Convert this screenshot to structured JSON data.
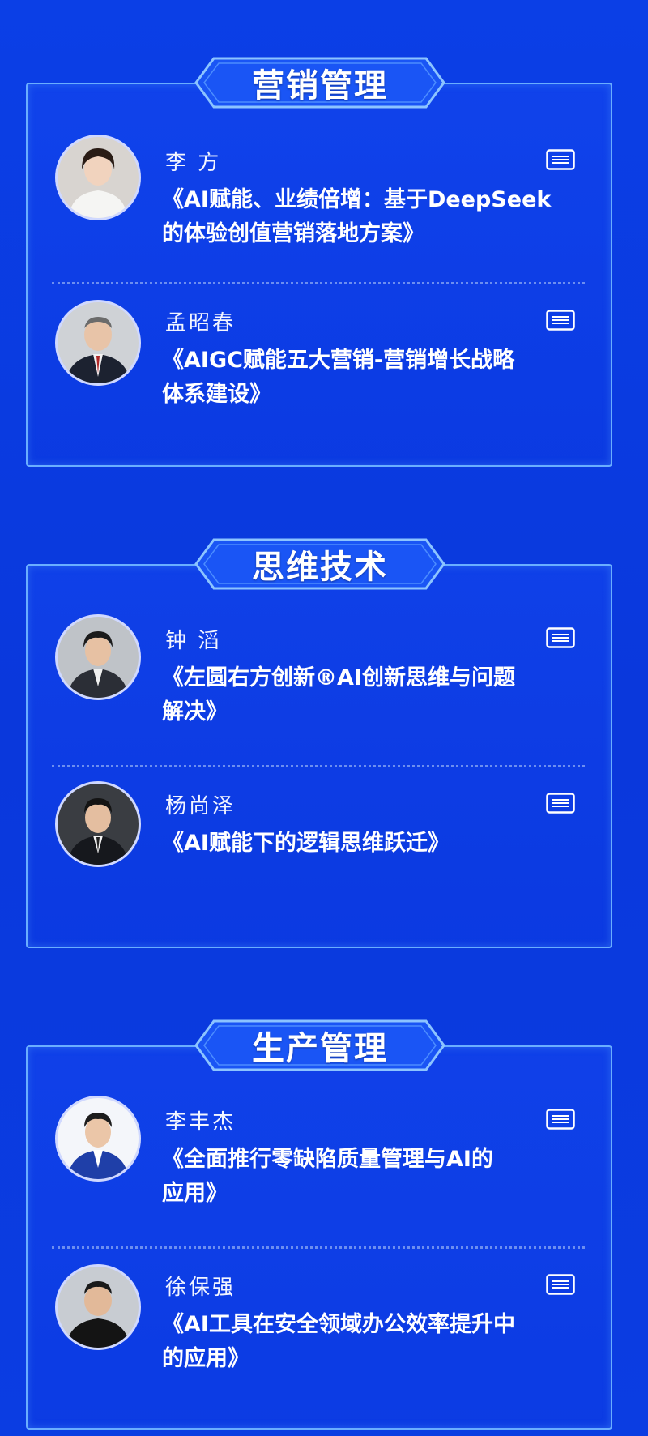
{
  "sections": [
    {
      "badge": "营销管理",
      "speakers": [
        {
          "name": "李 方",
          "title": "《AI赋能、业绩倍增：基于DeepSeek\n的体验创值营销落地方案》"
        },
        {
          "name": "孟昭春",
          "title": "《AIGC赋能五大营销-营销增长战略\n体系建设》"
        }
      ]
    },
    {
      "badge": "思维技术",
      "speakers": [
        {
          "name": "钟 滔",
          "title": "《左圆右方创新®AI创新思维与问题\n解决》"
        },
        {
          "name": "杨尚泽",
          "title": "《AI赋能下的逻辑思维跃迁》"
        }
      ]
    },
    {
      "badge": "生产管理",
      "speakers": [
        {
          "name": "李丰杰",
          "title": "《全面推行零缺陷质量管理与AI的\n应用》"
        },
        {
          "name": "徐保强",
          "title": "《AI工具在安全领域办公效率提升中\n的应用》"
        }
      ]
    }
  ],
  "icons": {
    "detail": "document-list-icon"
  },
  "colors": {
    "background": "#0a38dc",
    "border": "#6aaeff",
    "badge": "#1a55f5"
  }
}
